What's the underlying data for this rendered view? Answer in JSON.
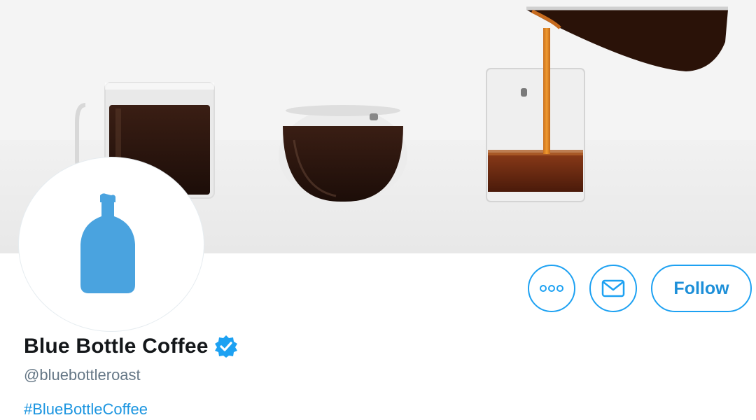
{
  "profile": {
    "display_name": "Blue Bottle Coffee",
    "handle": "@bluebottleroast",
    "hashtag": "#BlueBottleCoffee",
    "verified": true
  },
  "actions": {
    "more_icon": "more-horizontal-icon",
    "message_icon": "envelope-icon",
    "follow_label": "Follow"
  },
  "colors": {
    "accent": "#1da1f2",
    "link": "#1b95e0",
    "logo_blue": "#4aa3df",
    "text_primary": "#14171a",
    "text_secondary": "#657786"
  }
}
